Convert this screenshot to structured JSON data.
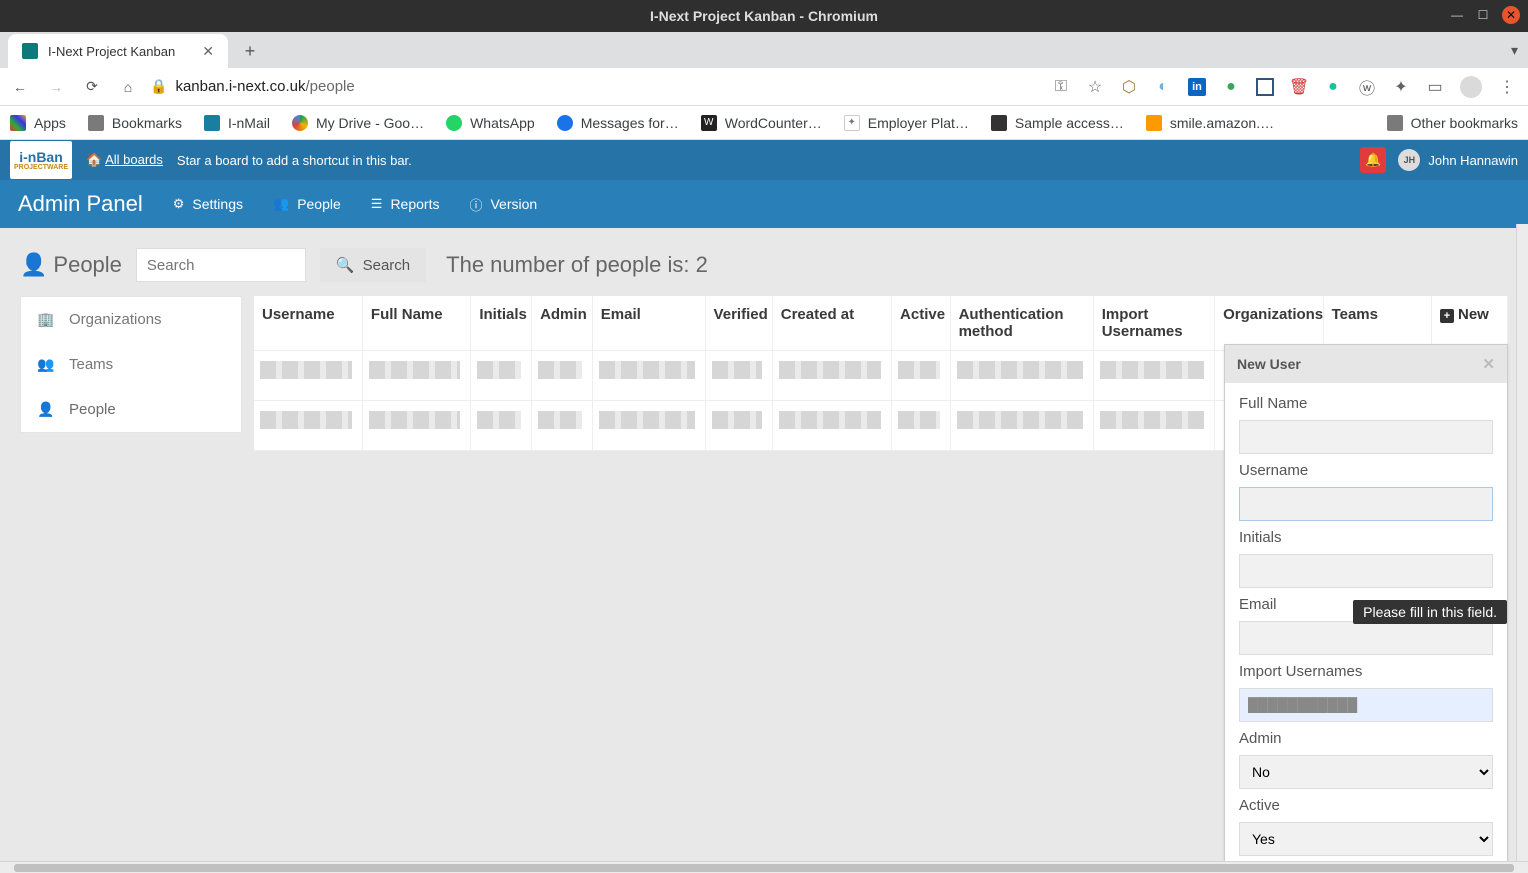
{
  "os": {
    "title": "I-Next Project Kanban - Chromium"
  },
  "browser": {
    "tab_title": "I-Next Project Kanban",
    "url_host": "kanban.i-next.co.uk",
    "url_path": "/people",
    "bookmarks": [
      {
        "label": "Apps",
        "icon": "apps"
      },
      {
        "label": "Bookmarks",
        "icon": "folder"
      },
      {
        "label": "I-nMail",
        "icon": "mail"
      },
      {
        "label": "My Drive - Goo…",
        "icon": "drive"
      },
      {
        "label": "WhatsApp",
        "icon": "whatsapp"
      },
      {
        "label": "Messages for…",
        "icon": "messages"
      },
      {
        "label": "WordCounter…",
        "icon": "w"
      },
      {
        "label": "Employer Plat…",
        "icon": "generic"
      },
      {
        "label": "Sample access…",
        "icon": "db"
      },
      {
        "label": "smile.amazon.…",
        "icon": "amazon"
      }
    ],
    "other_bookmarks": "Other bookmarks"
  },
  "app": {
    "all_boards": "All boards",
    "star_hint": "Star a board to add a shortcut in this bar.",
    "user_initials": "JH",
    "user_name": "John Hannawin",
    "admin_title": "Admin Panel",
    "nav": {
      "settings": "Settings",
      "people": "People",
      "reports": "Reports",
      "version": "Version"
    }
  },
  "page": {
    "title": "People",
    "search_placeholder": "Search",
    "search_btn": "Search",
    "count_text": "The number of people is: 2",
    "side": {
      "organizations": "Organizations",
      "teams": "Teams",
      "people": "People"
    },
    "columns": {
      "username": "Username",
      "full_name": "Full Name",
      "initials": "Initials",
      "admin": "Admin",
      "email": "Email",
      "verified": "Verified",
      "created_at": "Created at",
      "active": "Active",
      "auth_method": "Authentication method",
      "import_usernames": "Import Usernames",
      "organizations": "Organizations",
      "teams": "Teams",
      "new": "New"
    }
  },
  "form": {
    "title": "New User",
    "full_name": "Full Name",
    "username": "Username",
    "initials": "Initials",
    "email": "Email",
    "import_usernames": "Import Usernames",
    "admin_label": "Admin",
    "admin_value": "No",
    "active_label": "Active",
    "active_value": "Yes",
    "tooltip": "Please fill in this field."
  }
}
